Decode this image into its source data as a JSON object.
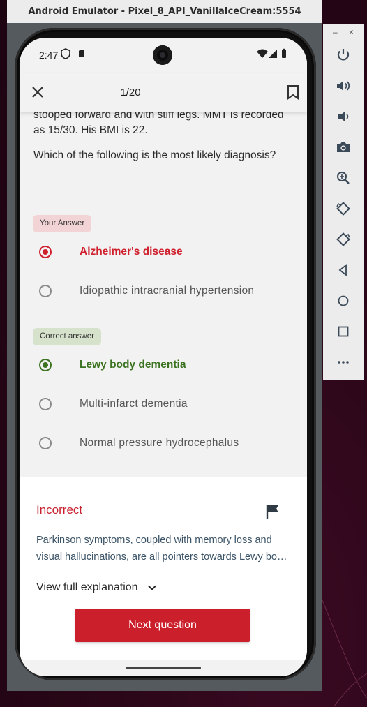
{
  "emulator": {
    "title": "Android Emulator - Pixel_8_API_VanillaIceCream:5554",
    "window_controls": {
      "minimize": "–",
      "close": "×"
    },
    "toolbar_icons": [
      "power-icon",
      "volume-up-icon",
      "volume-down-icon",
      "camera-icon",
      "zoom-icon",
      "rotate-left-icon",
      "rotate-right-icon",
      "back-icon",
      "home-icon",
      "overview-icon",
      "more-icon"
    ]
  },
  "status_bar": {
    "time": "2:47"
  },
  "app_bar": {
    "counter": "1/20"
  },
  "question": {
    "text_tail": "stooped forward and with stiff legs. MMT is recorded as 15/30. His BMI is 22.",
    "prompt": "Which of the following is the most likely diagnosis?"
  },
  "your_answer": {
    "chip_label": "Your Answer",
    "options": [
      "Alzheimer's disease",
      "Idiopathic intracranial hypertension"
    ]
  },
  "correct_answer": {
    "chip_label": "Correct answer",
    "options": [
      "Lewy body dementia",
      "Multi-infarct dementia",
      "Normal pressure hydrocephalus"
    ]
  },
  "feedback": {
    "status": "Incorrect",
    "explanation": "Parkinson symptoms, coupled with memory loss and visual hallucinations, are all pointers towards Lewy body dementia.",
    "view_full_label": "View full explanation",
    "next_button_label": "Next question"
  },
  "colors": {
    "incorrect_red": "#d0202e",
    "correct_green": "#3b7321",
    "primary_button": "#cc1f2c"
  }
}
